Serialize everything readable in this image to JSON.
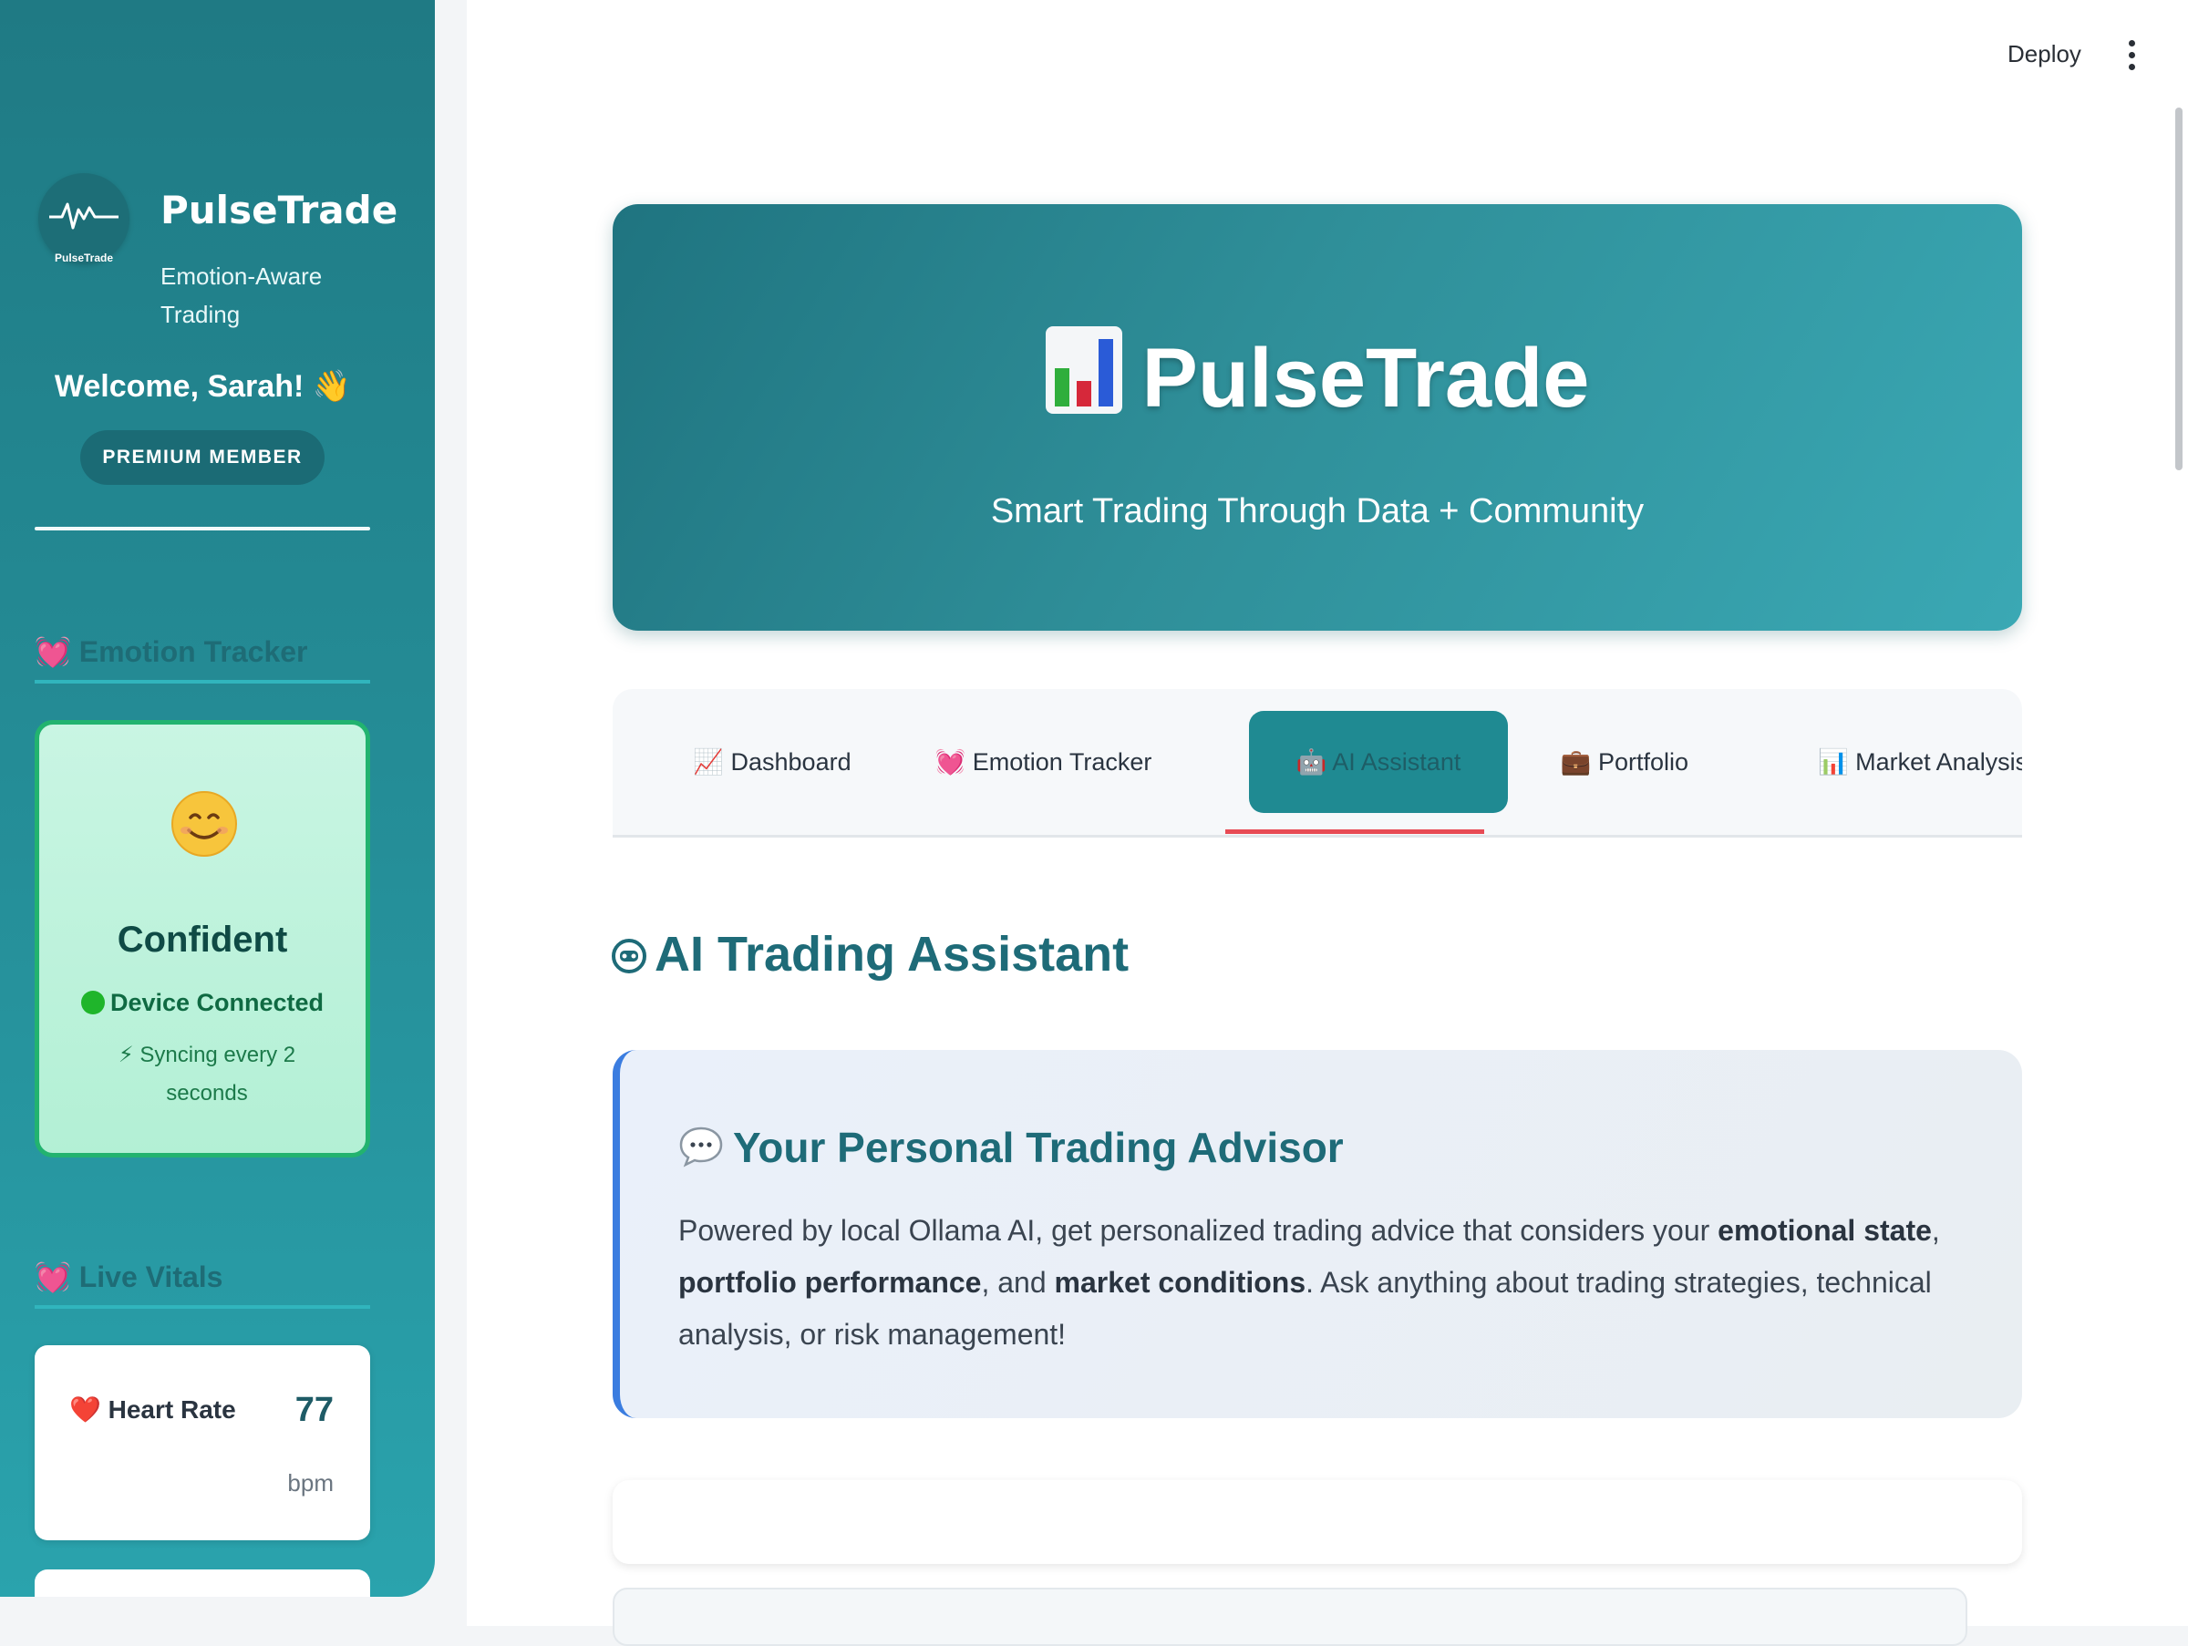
{
  "colors": {
    "sidebar": "#258f99",
    "hero": "#2f8f99",
    "accent_red": "#e84b55",
    "accent_blue": "#3b7de0",
    "emotion_green": "#22b36f"
  },
  "topbar": {
    "deploy_label": "Deploy",
    "menu_icon": "kebab-menu-icon"
  },
  "sidebar": {
    "logo_text": "PulseTrade",
    "brand_name": "PulseTrade",
    "tagline": "Emotion-Aware Trading",
    "welcome": "Welcome, Sarah! 👋",
    "member_badge": "PREMIUM MEMBER",
    "emotion_section": "💓 Emotion Tracker",
    "emotion": {
      "label": "Confident",
      "icon": "smiling-face-icon",
      "device_status": "Device Connected",
      "sync_text": "⚡ Syncing every 2 seconds"
    },
    "vitals_section": "💓 Live Vitals",
    "vitals": [
      {
        "label": "❤️ Heart Rate",
        "value": "77",
        "unit": "bpm"
      }
    ]
  },
  "hero": {
    "title": "PulseTrade",
    "subtitle": "Smart Trading Through Data + Community"
  },
  "tabs": [
    {
      "label": "📈 Dashboard"
    },
    {
      "label": "💓 Emotion Tracker"
    },
    {
      "label": "🤖 AI Assistant",
      "active": true
    },
    {
      "label": "💼 Portfolio"
    },
    {
      "label": "📊 Market Analysis"
    }
  ],
  "main": {
    "section_title": "AI Trading Assistant",
    "advisor": {
      "title": "Your Personal Trading Advisor",
      "text_1": "Powered by local Ollama AI, get personalized trading advice that considers your ",
      "bold_1": "emotional state",
      "text_2": ", ",
      "bold_2": "portfolio performance",
      "text_3": ", and ",
      "bold_3": "market conditions",
      "text_4": ". Ask anything about trading strategies, technical analysis, or risk management!"
    }
  }
}
